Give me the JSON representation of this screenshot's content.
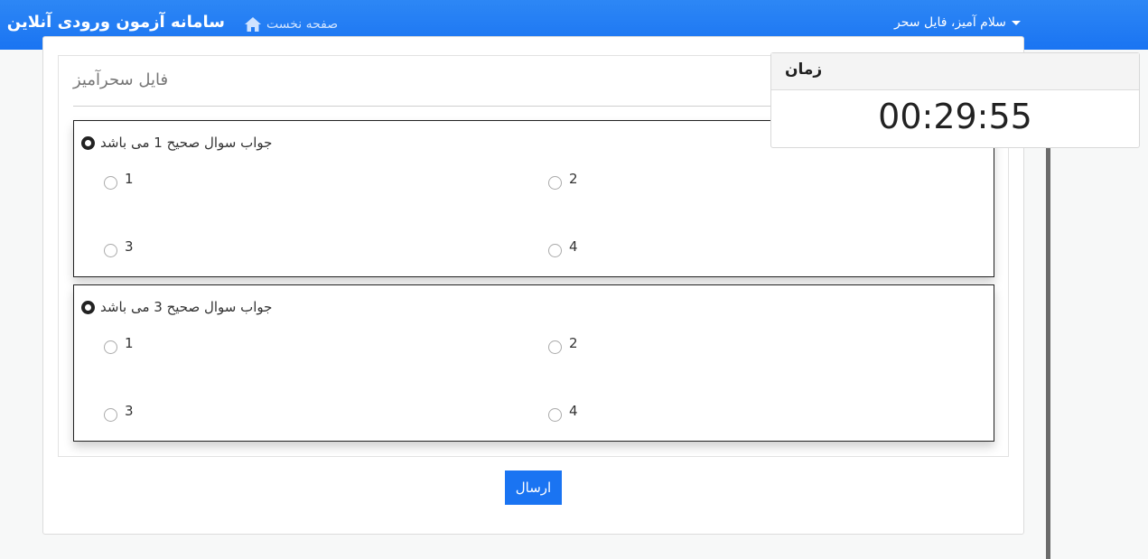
{
  "navbar": {
    "brand": "سامانه آزمون ورودی آنلاین",
    "home_label": "صفحه نخست",
    "user_greeting": "سلام آمیز، فایل سحر"
  },
  "exam": {
    "title": "فایل سحرآمیز",
    "questions": [
      {
        "text": "جواب سوال صحیح 1 می باشد",
        "options": [
          "1",
          "2",
          "3",
          "4"
        ]
      },
      {
        "text": "جواب سوال صحیح 3 می باشد",
        "options": [
          "1",
          "2",
          "3",
          "4"
        ]
      }
    ],
    "submit_label": "ارسال"
  },
  "timer": {
    "title": "زمان",
    "value": "00:29:55"
  },
  "colors": {
    "accent": "#1a74f2",
    "navbar": "#2d87f5"
  }
}
